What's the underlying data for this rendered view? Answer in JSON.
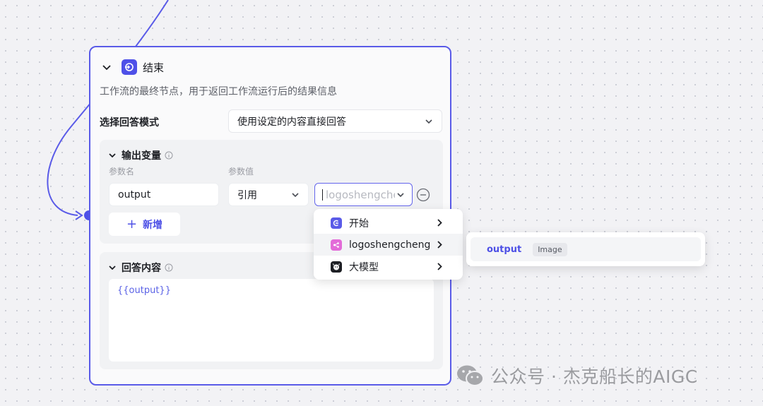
{
  "node": {
    "title": "结束",
    "description": "工作流的最终节点，用于返回工作流运行后的结果信息",
    "accent_color": "#4e50e8"
  },
  "answer_mode": {
    "label": "选择回答模式",
    "selected": "使用设定的内容直接回答"
  },
  "output_section": {
    "title": "输出变量",
    "col_name": "参数名",
    "col_value": "参数值",
    "param_name": "output",
    "ref_type": "引用",
    "value_placeholder": "logoshengcheng",
    "add_label": "新增"
  },
  "answer_section": {
    "title": "回答内容",
    "content": "{{output}}"
  },
  "menu": {
    "items": [
      {
        "label": "开始",
        "icon": "start-icon",
        "color": "#5a5be8"
      },
      {
        "label": "logoshengcheng",
        "icon": "workflow-icon",
        "color": "#e36bd8"
      },
      {
        "label": "大模型",
        "icon": "llm-icon",
        "color": "#1d1f24"
      }
    ]
  },
  "submenu": {
    "name": "output",
    "type": "Image"
  },
  "watermark": {
    "text": "公众号 · 杰克船长的AIGC"
  }
}
